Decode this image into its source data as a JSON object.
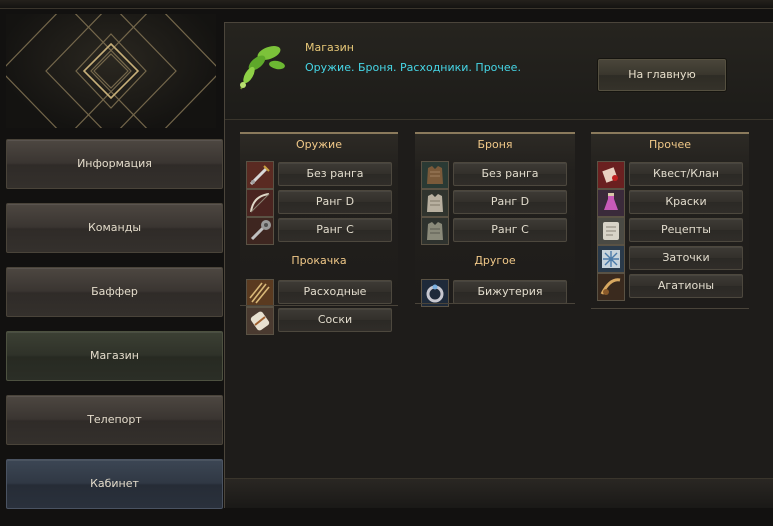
{
  "nav": [
    {
      "label": "Информация"
    },
    {
      "label": "Команды"
    },
    {
      "label": "Баффер"
    },
    {
      "label": "Магазин"
    },
    {
      "label": "Телепорт"
    },
    {
      "label": "Кабинет"
    }
  ],
  "header": {
    "title": "Магазин",
    "subtitle": "Оружие. Броня. Расходники. Прочее.",
    "home_button": "На главную",
    "icon": "leaf-icon"
  },
  "columns": {
    "weapons": {
      "title": "Оружие",
      "items": [
        {
          "label": "Без ранга",
          "icon": "sword-icon"
        },
        {
          "label": "Ранг D",
          "icon": "bow-icon"
        },
        {
          "label": "Ранг C",
          "icon": "mace-icon"
        }
      ],
      "sub_title": "Прокачка",
      "sub_items": [
        {
          "label": "Расходные",
          "icon": "arrows-icon"
        },
        {
          "label": "Соски",
          "icon": "soulshot-icon"
        }
      ]
    },
    "armor": {
      "title": "Броня",
      "items": [
        {
          "label": "Без ранга",
          "icon": "armor-icon"
        },
        {
          "label": "Ранг D",
          "icon": "armor-icon"
        },
        {
          "label": "Ранг C",
          "icon": "armor-icon"
        }
      ],
      "sub_title": "Другое",
      "sub_items": [
        {
          "label": "Бижутерия",
          "icon": "ring-icon"
        }
      ]
    },
    "other": {
      "title": "Прочее",
      "items": [
        {
          "label": "Квест/Клан",
          "icon": "quest-icon"
        },
        {
          "label": "Краски",
          "icon": "dye-icon"
        },
        {
          "label": "Рецепты",
          "icon": "recipe-icon"
        },
        {
          "label": "Заточки",
          "icon": "enchant-icon"
        },
        {
          "label": "Агатионы",
          "icon": "agathion-icon"
        }
      ]
    }
  },
  "colors": {
    "accent": "#e8c878",
    "subtitle": "#46d6e6",
    "column_title": "#f0c888"
  }
}
